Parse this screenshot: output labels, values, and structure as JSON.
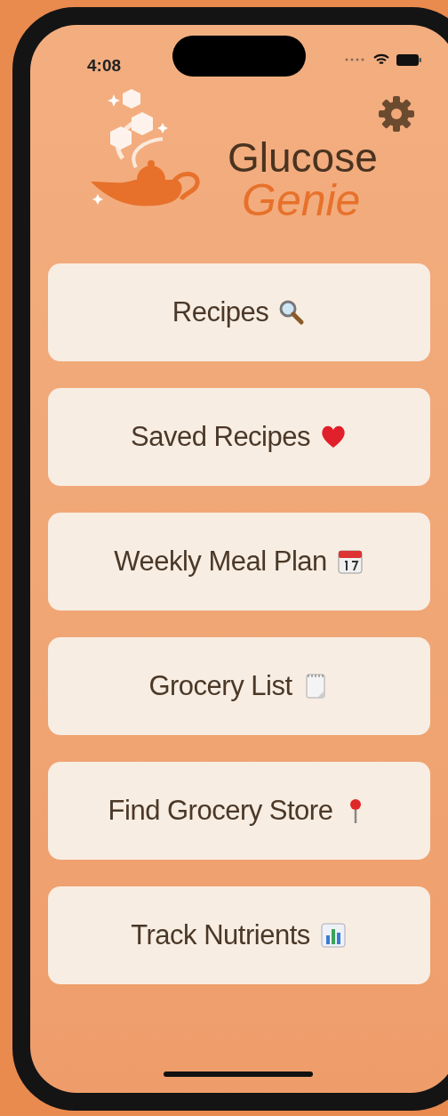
{
  "status_bar": {
    "time": "4:08"
  },
  "logo": {
    "line_1": "Glucose",
    "line_2": "Genie"
  },
  "menu": [
    {
      "label": "Recipes",
      "kind": "search"
    },
    {
      "label": "Saved Recipes",
      "kind": "heart"
    },
    {
      "label": "Weekly Meal Plan",
      "kind": "calendar"
    },
    {
      "label": "Grocery List",
      "kind": "notepad"
    },
    {
      "label": "Find Grocery Store",
      "kind": "pin"
    },
    {
      "label": "Track Nutrients",
      "kind": "chart"
    }
  ]
}
